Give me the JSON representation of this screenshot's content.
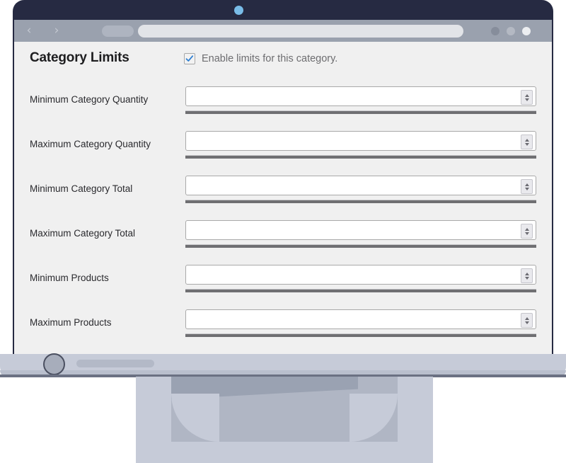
{
  "device": {
    "type": "laptop-mockup",
    "bezel_color": "#262a42",
    "base_color": "#c6cbd8",
    "webcam_color": "#79bce8"
  },
  "browser": {
    "back_icon": "‹",
    "forward_icon": "›",
    "tab_label": "",
    "url_value": "",
    "window_dots": [
      "#868d9b",
      "#b4b9c3",
      "#eceef1"
    ]
  },
  "page": {
    "title": "Category Limits",
    "enable": {
      "label": "Enable limits for this category.",
      "checked": true,
      "check_color": "#2f7fd1"
    },
    "rows": [
      {
        "label": "Minimum Category Quantity",
        "value": "",
        "placeholder": ""
      },
      {
        "label": "Maximum Category Quantity",
        "value": "",
        "placeholder": ""
      },
      {
        "label": "Minimum Category Total",
        "value": "",
        "placeholder": ""
      },
      {
        "label": "Maximum Category Total",
        "value": "",
        "placeholder": ""
      },
      {
        "label": "Minimum Products",
        "value": "",
        "placeholder": ""
      },
      {
        "label": "Maximum Products",
        "value": "",
        "placeholder": ""
      }
    ]
  }
}
